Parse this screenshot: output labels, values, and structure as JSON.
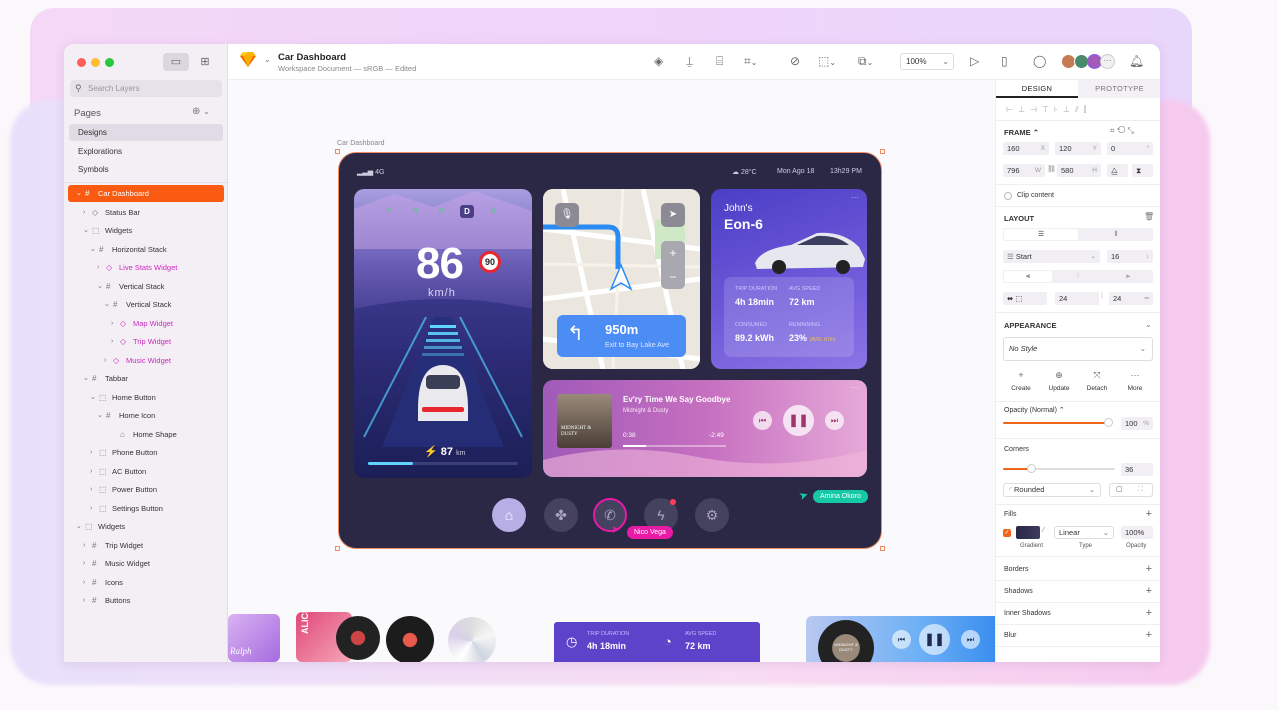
{
  "app": {
    "doc_title": "Car Dashboard",
    "doc_subtitle": "Workspace Document — sRGB — Edited",
    "zoom": "100%"
  },
  "sidebar": {
    "search_placeholder": "Search Layers",
    "pages_header": "Pages",
    "pages": [
      "Designs",
      "Explorations",
      "Symbols"
    ],
    "layers": [
      {
        "label": "Car Dashboard",
        "depth": 0,
        "chev": "⌄",
        "icon": "#",
        "selected": true
      },
      {
        "label": "Status Bar",
        "depth": 1,
        "chev": "›",
        "icon": "◇",
        "sym": false
      },
      {
        "label": "Widgets",
        "depth": 1,
        "chev": "⌄",
        "icon": "⬚"
      },
      {
        "label": "Horizontal Stack",
        "depth": 2,
        "chev": "⌄",
        "icon": "#"
      },
      {
        "label": "Live Stats Widget",
        "depth": 3,
        "chev": "›",
        "icon": "◇",
        "sym": true
      },
      {
        "label": "Vertical Stack",
        "depth": 3,
        "chev": "⌄",
        "icon": "#"
      },
      {
        "label": "Vertical Stack",
        "depth": 4,
        "chev": "⌄",
        "icon": "#"
      },
      {
        "label": "Map Widget",
        "depth": 5,
        "chev": "›",
        "icon": "◇",
        "sym": true
      },
      {
        "label": "Trip Widget",
        "depth": 5,
        "chev": "›",
        "icon": "◇",
        "sym": true
      },
      {
        "label": "Music Widget",
        "depth": 4,
        "chev": "›",
        "icon": "◇",
        "sym": true
      },
      {
        "label": "Tabbar",
        "depth": 1,
        "chev": "⌄",
        "icon": "#"
      },
      {
        "label": "Home Button",
        "depth": 2,
        "chev": "⌄",
        "icon": "⬚"
      },
      {
        "label": "Home Icon",
        "depth": 3,
        "chev": "⌄",
        "icon": "#"
      },
      {
        "label": "Home Shape",
        "depth": 5,
        "chev": "",
        "icon": "⌂"
      },
      {
        "label": "Phone Button",
        "depth": 2,
        "chev": "›",
        "icon": "⬚"
      },
      {
        "label": "AC Button",
        "depth": 2,
        "chev": "›",
        "icon": "⬚"
      },
      {
        "label": "Power Button",
        "depth": 2,
        "chev": "›",
        "icon": "⬚"
      },
      {
        "label": "Settings Button",
        "depth": 2,
        "chev": "›",
        "icon": "⬚"
      },
      {
        "label": "Widgets",
        "depth": 0,
        "chev": "⌄",
        "icon": "⬚"
      },
      {
        "label": "Trip Widget",
        "depth": 1,
        "chev": "›",
        "icon": "#"
      },
      {
        "label": "Music Widget",
        "depth": 1,
        "chev": "›",
        "icon": "#"
      },
      {
        "label": "Icons",
        "depth": 1,
        "chev": "›",
        "icon": "#"
      },
      {
        "label": "Buttons",
        "depth": 1,
        "chev": "›",
        "icon": "#"
      }
    ]
  },
  "canvas": {
    "frame_label": "Car Dashboard",
    "status": {
      "signal": "4G",
      "weather": "28°C",
      "date": "Mon Ago 18",
      "time": "13h29 PM"
    },
    "speed_widget": {
      "gears": [
        "P",
        "R",
        "N",
        "D",
        "S"
      ],
      "active_gear": "D",
      "speed": "86",
      "unit": "km/h",
      "limit": "90",
      "range": "87",
      "range_unit": "km",
      "range_fill": 0.3
    },
    "trip_widget": {
      "owner": "John's",
      "model": "Eon-6",
      "trip_duration_label": "TRIP DURATION",
      "trip_duration": "4h 18min",
      "avg_speed_label": "AVG SPEED",
      "avg_speed": "72 km",
      "consumed_label": "CONSUMED",
      "consumed": "89.2 kWh",
      "remaining_label": "REMAINING",
      "remaining": "23%",
      "remaining_note": "(AVG: 87m)"
    },
    "map_widget": {
      "distance": "950m",
      "direction": "Exit to Bay Lake Ave"
    },
    "music_widget": {
      "song": "Ev'ry Time We Say Goodbye",
      "artist": "Midnight & Dusty",
      "elapsed": "0:38",
      "remaining": "-2:49",
      "album_text": "MIDNIGHT & DUSTY",
      "progress": 0.22
    },
    "cursors": [
      {
        "name": "Amina Okoro",
        "color": "#15c9a6"
      },
      {
        "name": "Nico Vega",
        "color": "#e81aa6"
      }
    ],
    "bottom_card": {
      "trip_duration_label": "TRIP DURATION",
      "trip_duration": "4h 18min",
      "avg_speed_label": "AVG SPEED",
      "avg_speed": "72 km"
    },
    "bottom_album_text": "MIDNIGHT & DUSTY",
    "cover_texts": [
      "ALICE",
      "Ralph"
    ]
  },
  "inspector": {
    "tabs": [
      "DESIGN",
      "PROTOTYPE"
    ],
    "frame_label": "FRAME",
    "x": "160",
    "y": "120",
    "rotation": "0",
    "w": "796",
    "h": "580",
    "x_label": "X",
    "y_label": "Y",
    "rot_suffix": "°",
    "w_label": "W",
    "h_label": "H",
    "clip_content": "Clip content",
    "layout_label": "LAYOUT",
    "align": "Start",
    "spacing": "16",
    "padding_h": "24",
    "padding_v": "24",
    "appearance_label": "APPEARANCE",
    "style": "No Style",
    "style_actions": [
      "Create",
      "Update",
      "Detach",
      "More"
    ],
    "opacity_label": "Opacity (Normal)",
    "opacity": "100",
    "opacity_unit": "%",
    "opacity_fill": 1.0,
    "corners_label": "Corners",
    "corners": "36",
    "corners_fill": 0.25,
    "corner_style": "Rounded",
    "fills_label": "Fills",
    "fill_type": "Linear",
    "fill_opacity": "100%",
    "fill_sublabels": [
      "Gradient",
      "Type",
      "Opacity"
    ],
    "more_sections": [
      "Borders",
      "Shadows",
      "Inner Shadows",
      "Blur"
    ]
  }
}
